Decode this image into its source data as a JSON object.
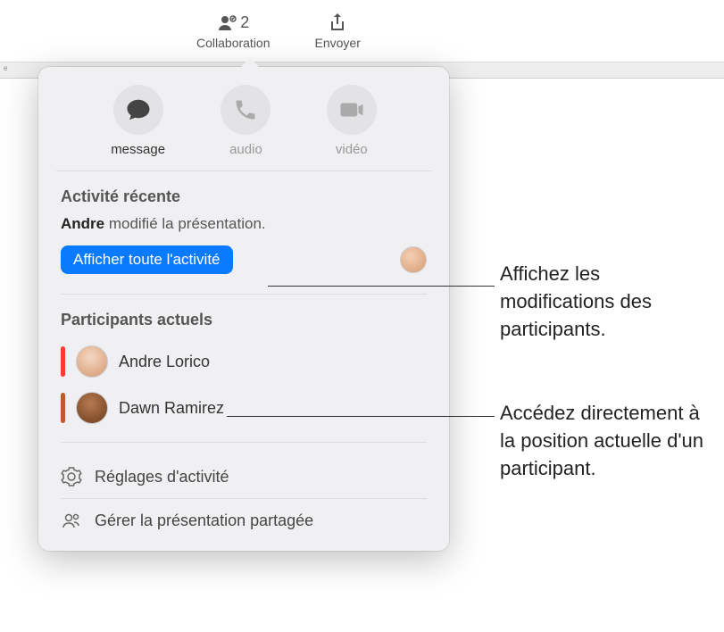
{
  "toolbar": {
    "collaboration_label": "Collaboration",
    "collaboration_count": "2",
    "share_label": "Envoyer"
  },
  "ruler": {
    "left_label": "e"
  },
  "comm": {
    "message": "message",
    "audio": "audio",
    "video": "vidéo"
  },
  "activity": {
    "heading": "Activité récente",
    "actor": "Andre",
    "action": " modifié la présentation.",
    "show_all": "Afficher toute l'activité"
  },
  "participants": {
    "heading": "Participants actuels",
    "items": [
      {
        "name": "Andre Lorico",
        "color": "red"
      },
      {
        "name": "Dawn Ramirez",
        "color": "orange"
      }
    ]
  },
  "bottom": {
    "activity_settings": "Réglages d'activité",
    "manage_shared": "Gérer la présentation partagée"
  },
  "callouts": {
    "c1": "Affichez les modifications des participants.",
    "c2": "Accédez directement à la position actuelle d'un participant."
  }
}
